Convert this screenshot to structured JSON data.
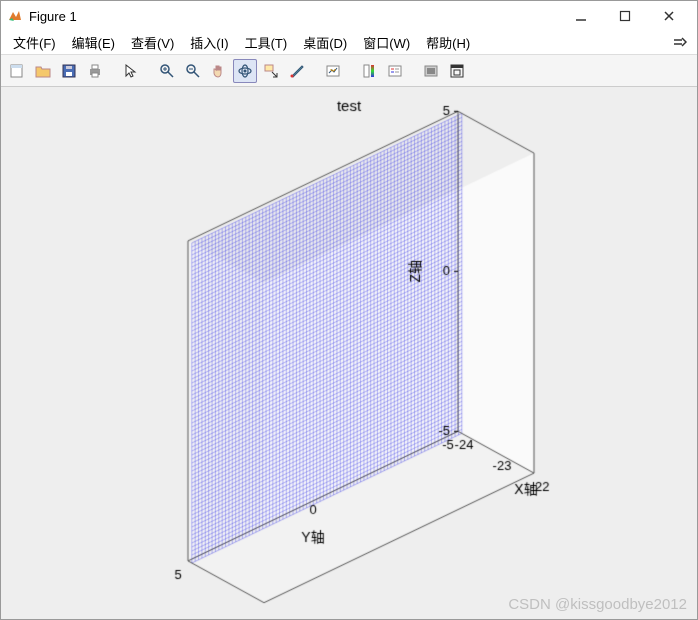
{
  "window": {
    "title": "Figure 1"
  },
  "menubar": {
    "items": [
      "文件(F)",
      "编辑(E)",
      "查看(V)",
      "插入(I)",
      "工具(T)",
      "桌面(D)",
      "窗口(W)",
      "帮助(H)"
    ]
  },
  "toolbar": {
    "buttons": [
      {
        "name": "new-figure-icon"
      },
      {
        "name": "open-icon"
      },
      {
        "name": "save-icon"
      },
      {
        "name": "print-icon"
      },
      {
        "name": "sep"
      },
      {
        "name": "pointer-icon"
      },
      {
        "name": "sep"
      },
      {
        "name": "zoom-in-icon"
      },
      {
        "name": "zoom-out-icon"
      },
      {
        "name": "pan-icon"
      },
      {
        "name": "rotate3d-icon",
        "active": true
      },
      {
        "name": "data-cursor-icon"
      },
      {
        "name": "brush-icon"
      },
      {
        "name": "sep"
      },
      {
        "name": "link-plot-icon"
      },
      {
        "name": "sep"
      },
      {
        "name": "colorbar-icon"
      },
      {
        "name": "legend-icon"
      },
      {
        "name": "sep"
      },
      {
        "name": "hide-icon"
      },
      {
        "name": "dock-icon"
      }
    ]
  },
  "chart_data": {
    "type": "surface",
    "title": "test",
    "xlabel": "X轴",
    "ylabel": "Y轴",
    "zlabel": "Z轴",
    "xticks": [
      -24,
      -23,
      -22
    ],
    "yticks": [
      -5,
      0,
      5
    ],
    "zticks": [
      -5,
      0,
      5
    ],
    "xlim": [
      -24,
      -22
    ],
    "ylim": [
      -5,
      5
    ],
    "zlim": [
      -5,
      5
    ],
    "description": "Dense blue mesh grid on a near-vertical plane at approximately constant X, spanning Y in [-5,5] and Z in [-5,5]."
  },
  "watermark": "CSDN @kissgoodbye2012"
}
